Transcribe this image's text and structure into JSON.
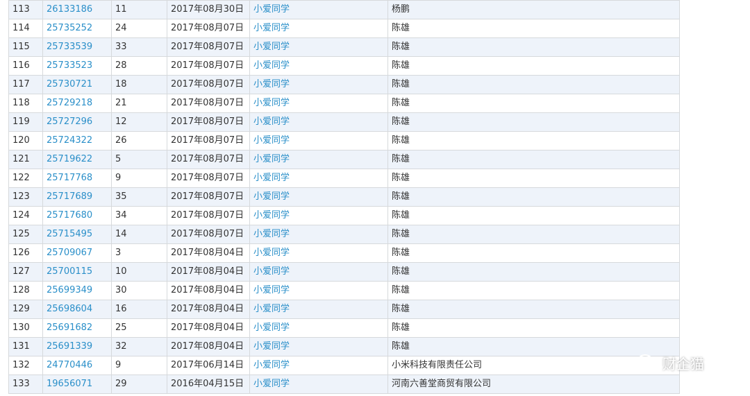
{
  "rows": [
    {
      "no": "113",
      "id": "26133186",
      "count": "11",
      "date": "2017年08月30日",
      "name": "小爱同学",
      "applicant": "杨鹏"
    },
    {
      "no": "114",
      "id": "25735252",
      "count": "24",
      "date": "2017年08月07日",
      "name": "小爱同学",
      "applicant": "陈雄"
    },
    {
      "no": "115",
      "id": "25733539",
      "count": "33",
      "date": "2017年08月07日",
      "name": "小爱同学",
      "applicant": "陈雄"
    },
    {
      "no": "116",
      "id": "25733523",
      "count": "28",
      "date": "2017年08月07日",
      "name": "小爱同学",
      "applicant": "陈雄"
    },
    {
      "no": "117",
      "id": "25730721",
      "count": "18",
      "date": "2017年08月07日",
      "name": "小爱同学",
      "applicant": "陈雄"
    },
    {
      "no": "118",
      "id": "25729218",
      "count": "21",
      "date": "2017年08月07日",
      "name": "小爱同学",
      "applicant": "陈雄"
    },
    {
      "no": "119",
      "id": "25727296",
      "count": "12",
      "date": "2017年08月07日",
      "name": "小爱同学",
      "applicant": "陈雄"
    },
    {
      "no": "120",
      "id": "25724322",
      "count": "26",
      "date": "2017年08月07日",
      "name": "小爱同学",
      "applicant": "陈雄"
    },
    {
      "no": "121",
      "id": "25719622",
      "count": "5",
      "date": "2017年08月07日",
      "name": "小爱同学",
      "applicant": "陈雄"
    },
    {
      "no": "122",
      "id": "25717768",
      "count": "9",
      "date": "2017年08月07日",
      "name": "小爱同学",
      "applicant": "陈雄"
    },
    {
      "no": "123",
      "id": "25717689",
      "count": "35",
      "date": "2017年08月07日",
      "name": "小爱同学",
      "applicant": "陈雄"
    },
    {
      "no": "124",
      "id": "25717680",
      "count": "34",
      "date": "2017年08月07日",
      "name": "小爱同学",
      "applicant": "陈雄"
    },
    {
      "no": "125",
      "id": "25715495",
      "count": "14",
      "date": "2017年08月07日",
      "name": "小爱同学",
      "applicant": "陈雄"
    },
    {
      "no": "126",
      "id": "25709067",
      "count": "3",
      "date": "2017年08月04日",
      "name": "小爱同学",
      "applicant": "陈雄"
    },
    {
      "no": "127",
      "id": "25700115",
      "count": "10",
      "date": "2017年08月04日",
      "name": "小爱同学",
      "applicant": "陈雄"
    },
    {
      "no": "128",
      "id": "25699349",
      "count": "30",
      "date": "2017年08月04日",
      "name": "小爱同学",
      "applicant": "陈雄"
    },
    {
      "no": "129",
      "id": "25698604",
      "count": "16",
      "date": "2017年08月04日",
      "name": "小爱同学",
      "applicant": "陈雄"
    },
    {
      "no": "130",
      "id": "25691682",
      "count": "25",
      "date": "2017年08月04日",
      "name": "小爱同学",
      "applicant": "陈雄"
    },
    {
      "no": "131",
      "id": "25691339",
      "count": "32",
      "date": "2017年08月04日",
      "name": "小爱同学",
      "applicant": "陈雄"
    },
    {
      "no": "132",
      "id": "24770446",
      "count": "9",
      "date": "2017年06月14日",
      "name": "小爱同学",
      "applicant": "小米科技有限责任公司"
    },
    {
      "no": "133",
      "id": "19656071",
      "count": "29",
      "date": "2016年04月15日",
      "name": "小爱同学",
      "applicant": "河南六善堂商贸有限公司"
    }
  ],
  "watermark": {
    "icon": "wechat-icon",
    "text": "财企猫"
  },
  "colors": {
    "link": "#2a8fc9",
    "stripe": "#eef3fa",
    "border": "#d6d9dc"
  }
}
